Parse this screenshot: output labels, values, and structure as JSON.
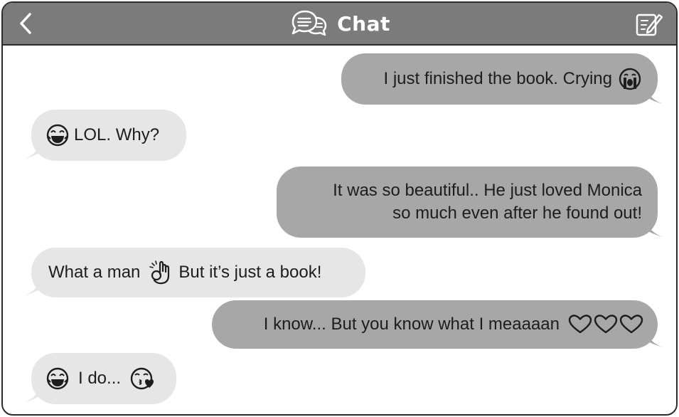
{
  "header": {
    "title": "Chat",
    "back_icon": "chevron-left-icon",
    "title_icon": "chat-bubbles-icon",
    "compose_icon": "compose-icon"
  },
  "colors": {
    "header_bg": "#7b7b7b",
    "outgoing_bubble": "#a7a7a7",
    "incoming_bubble": "#e6e6e6",
    "text": "#1d1d1d"
  },
  "messages": [
    {
      "side": "outgoing",
      "text": "I just finished the book. Crying",
      "emoji_after": "crying-face-icon"
    },
    {
      "side": "incoming",
      "text": "LOL. Why?",
      "emoji_before": "laughing-face-icon"
    },
    {
      "side": "outgoing",
      "line1": "It was so beautiful.. He just loved Monica",
      "line2": "so much even after he found out!"
    },
    {
      "side": "incoming",
      "text_before": "What a man",
      "emoji_mid": "ok-hand-icon",
      "text_after": "But it’s just a book!"
    },
    {
      "side": "outgoing",
      "text": "I know... But you know what I meaaaan",
      "emoji_after": "three-hearts-icon"
    },
    {
      "side": "incoming",
      "text": "I do...",
      "emoji_before": "laughing-face-icon",
      "emoji_after": "kissing-face-icon"
    }
  ]
}
